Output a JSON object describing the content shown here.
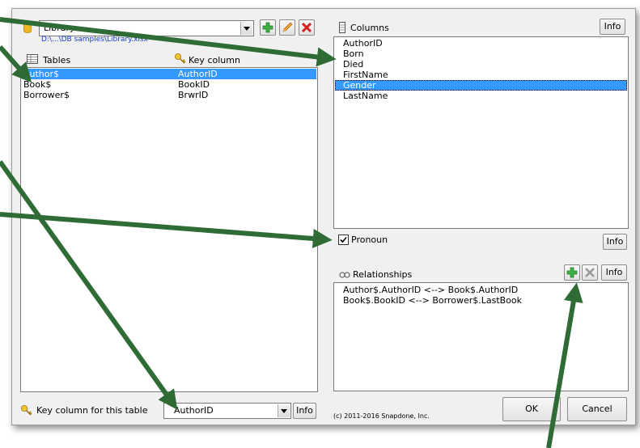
{
  "datasource": {
    "selected": "Library",
    "path": "D:\\...\\DB samples\\Library.xlsx"
  },
  "tables": {
    "header_label": "Tables",
    "key_header_label": "Key column",
    "rows": [
      {
        "name": "Author$",
        "key": "AuthorID",
        "selected": true
      },
      {
        "name": "Book$",
        "key": "BookID",
        "selected": false
      },
      {
        "name": "Borrower$",
        "key": "BrwrID",
        "selected": false
      }
    ]
  },
  "columns": {
    "header_label": "Columns",
    "info_label": "Info",
    "items": [
      "AuthorID",
      "Born",
      "Died",
      "FirstName",
      "Gender",
      "LastName"
    ],
    "selected": "Gender"
  },
  "pronoun": {
    "label": "Pronoun",
    "checked": true,
    "info_label": "Info"
  },
  "relationships": {
    "header_label": "Relationships",
    "info_label": "Info",
    "items": [
      "Author$.AuthorID <--> Book$.AuthorID",
      "Book$.BookID <--> Borrower$.LastBook"
    ]
  },
  "key_column": {
    "label": "Key column for this table",
    "value": "AuthorID",
    "info_label": "Info"
  },
  "footer": {
    "copyright": "(c) 2011-2016 Snapdone, Inc.",
    "ok_label": "OK",
    "cancel_label": "Cancel"
  },
  "colors": {
    "selection": "#3399ff",
    "annotation_arrow": "#2e6b35",
    "add_icon": "#3cb043",
    "delete_icon": "#d42020"
  },
  "icons": [
    "database-icon",
    "add-icon",
    "edit-icon",
    "delete-icon",
    "table-icon",
    "key-icon",
    "columns-icon",
    "relationships-icon"
  ]
}
